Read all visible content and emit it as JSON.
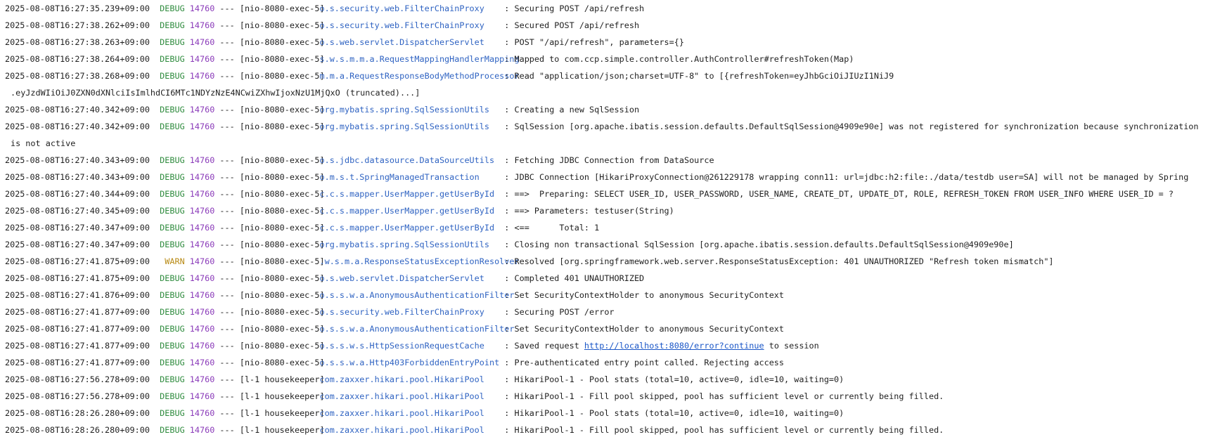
{
  "log": {
    "entries": [
      {
        "ts": "2025-08-08T16:27:35.239+09:00",
        "level": "DEBUG",
        "pid": "14760",
        "sep": "---",
        "thread": "[nio-8080-exec-5]",
        "logger": "o.s.security.web.FilterChainProxy",
        "message": "Securing POST /api/refresh"
      },
      {
        "ts": "2025-08-08T16:27:38.262+09:00",
        "level": "DEBUG",
        "pid": "14760",
        "sep": "---",
        "thread": "[nio-8080-exec-5]",
        "logger": "o.s.security.web.FilterChainProxy",
        "message": "Secured POST /api/refresh"
      },
      {
        "ts": "2025-08-08T16:27:38.263+09:00",
        "level": "DEBUG",
        "pid": "14760",
        "sep": "---",
        "thread": "[nio-8080-exec-5]",
        "logger": "o.s.web.servlet.DispatcherServlet",
        "message": "POST \"/api/refresh\", parameters={}"
      },
      {
        "ts": "2025-08-08T16:27:38.264+09:00",
        "level": "DEBUG",
        "pid": "14760",
        "sep": "---",
        "thread": "[nio-8080-exec-5]",
        "logger": "s.w.s.m.m.a.RequestMappingHandlerMapping",
        "message": "Mapped to com.ccp.simple.controller.AuthController#refreshToken(Map)"
      },
      {
        "ts": "2025-08-08T16:27:38.268+09:00",
        "level": "DEBUG",
        "pid": "14760",
        "sep": "---",
        "thread": "[nio-8080-exec-5]",
        "logger": "m.m.a.RequestResponseBodyMethodProcessor",
        "message": "Read \"application/json;charset=UTF-8\" to [{refreshToken=eyJhbGciOiJIUzI1NiJ9",
        "continuation": ".eyJzdWIiOiJ0ZXN0dXNlciIsImlhdCI6MTc1NDYzNzE4NCwiZXhwIjoxNzU1MjQxO (truncated)...]"
      },
      {
        "ts": "2025-08-08T16:27:40.342+09:00",
        "level": "DEBUG",
        "pid": "14760",
        "sep": "---",
        "thread": "[nio-8080-exec-5]",
        "logger": "org.mybatis.spring.SqlSessionUtils",
        "message": "Creating a new SqlSession"
      },
      {
        "ts": "2025-08-08T16:27:40.342+09:00",
        "level": "DEBUG",
        "pid": "14760",
        "sep": "---",
        "thread": "[nio-8080-exec-5]",
        "logger": "org.mybatis.spring.SqlSessionUtils",
        "message": "SqlSession [org.apache.ibatis.session.defaults.DefaultSqlSession@4909e90e] was not registered for synchronization because synchronization",
        "continuation": "is not active"
      },
      {
        "ts": "2025-08-08T16:27:40.343+09:00",
        "level": "DEBUG",
        "pid": "14760",
        "sep": "---",
        "thread": "[nio-8080-exec-5]",
        "logger": "o.s.jdbc.datasource.DataSourceUtils",
        "message": "Fetching JDBC Connection from DataSource"
      },
      {
        "ts": "2025-08-08T16:27:40.343+09:00",
        "level": "DEBUG",
        "pid": "14760",
        "sep": "---",
        "thread": "[nio-8080-exec-5]",
        "logger": "o.m.s.t.SpringManagedTransaction",
        "message": "JDBC Connection [HikariProxyConnection@261229178 wrapping conn11: url=jdbc:h2:file:./data/testdb user=SA] will not be managed by Spring"
      },
      {
        "ts": "2025-08-08T16:27:40.344+09:00",
        "level": "DEBUG",
        "pid": "14760",
        "sep": "---",
        "thread": "[nio-8080-exec-5]",
        "logger": "c.c.s.mapper.UserMapper.getUserById",
        "message": "==>  Preparing: SELECT USER_ID, USER_PASSWORD, USER_NAME, CREATE_DT, UPDATE_DT, ROLE, REFRESH_TOKEN FROM USER_INFO WHERE USER_ID = ?"
      },
      {
        "ts": "2025-08-08T16:27:40.345+09:00",
        "level": "DEBUG",
        "pid": "14760",
        "sep": "---",
        "thread": "[nio-8080-exec-5]",
        "logger": "c.c.s.mapper.UserMapper.getUserById",
        "message": "==> Parameters: testuser(String)"
      },
      {
        "ts": "2025-08-08T16:27:40.347+09:00",
        "level": "DEBUG",
        "pid": "14760",
        "sep": "---",
        "thread": "[nio-8080-exec-5]",
        "logger": "c.c.s.mapper.UserMapper.getUserById",
        "message": "<==      Total: 1"
      },
      {
        "ts": "2025-08-08T16:27:40.347+09:00",
        "level": "DEBUG",
        "pid": "14760",
        "sep": "---",
        "thread": "[nio-8080-exec-5]",
        "logger": "org.mybatis.spring.SqlSessionUtils",
        "message": "Closing non transactional SqlSession [org.apache.ibatis.session.defaults.DefaultSqlSession@4909e90e]"
      },
      {
        "ts": "2025-08-08T16:27:41.875+09:00",
        "level": "WARN",
        "pid": "14760",
        "sep": "---",
        "thread": "[nio-8080-exec-5]",
        "logger": ".w.s.m.a.ResponseStatusExceptionResolver",
        "message": "Resolved [org.springframework.web.server.ResponseStatusException: 401 UNAUTHORIZED \"Refresh token mismatch\"]"
      },
      {
        "ts": "2025-08-08T16:27:41.875+09:00",
        "level": "DEBUG",
        "pid": "14760",
        "sep": "---",
        "thread": "[nio-8080-exec-5]",
        "logger": "o.s.web.servlet.DispatcherServlet",
        "message": "Completed 401 UNAUTHORIZED"
      },
      {
        "ts": "2025-08-08T16:27:41.876+09:00",
        "level": "DEBUG",
        "pid": "14760",
        "sep": "---",
        "thread": "[nio-8080-exec-5]",
        "logger": "o.s.s.w.a.AnonymousAuthenticationFilter",
        "message": "Set SecurityContextHolder to anonymous SecurityContext"
      },
      {
        "ts": "2025-08-08T16:27:41.877+09:00",
        "level": "DEBUG",
        "pid": "14760",
        "sep": "---",
        "thread": "[nio-8080-exec-5]",
        "logger": "o.s.security.web.FilterChainProxy",
        "message": "Securing POST /error"
      },
      {
        "ts": "2025-08-08T16:27:41.877+09:00",
        "level": "DEBUG",
        "pid": "14760",
        "sep": "---",
        "thread": "[nio-8080-exec-5]",
        "logger": "o.s.s.w.a.AnonymousAuthenticationFilter",
        "message": "Set SecurityContextHolder to anonymous SecurityContext"
      },
      {
        "ts": "2025-08-08T16:27:41.877+09:00",
        "level": "DEBUG",
        "pid": "14760",
        "sep": "---",
        "thread": "[nio-8080-exec-5]",
        "logger": "o.s.s.w.s.HttpSessionRequestCache",
        "message": "Saved request ",
        "url": "http://localhost:8080/error?continue",
        "message_after": " to session"
      },
      {
        "ts": "2025-08-08T16:27:41.877+09:00",
        "level": "DEBUG",
        "pid": "14760",
        "sep": "---",
        "thread": "[nio-8080-exec-5]",
        "logger": "o.s.s.w.a.Http403ForbiddenEntryPoint",
        "message": "Pre-authenticated entry point called. Rejecting access"
      },
      {
        "ts": "2025-08-08T16:27:56.278+09:00",
        "level": "DEBUG",
        "pid": "14760",
        "sep": "---",
        "thread": "[l-1 housekeeper]",
        "logger": "com.zaxxer.hikari.pool.HikariPool",
        "message": "HikariPool-1 - Pool stats (total=10, active=0, idle=10, waiting=0)"
      },
      {
        "ts": "2025-08-08T16:27:56.278+09:00",
        "level": "DEBUG",
        "pid": "14760",
        "sep": "---",
        "thread": "[l-1 housekeeper]",
        "logger": "com.zaxxer.hikari.pool.HikariPool",
        "message": "HikariPool-1 - Fill pool skipped, pool has sufficient level or currently being filled."
      },
      {
        "ts": "2025-08-08T16:28:26.280+09:00",
        "level": "DEBUG",
        "pid": "14760",
        "sep": "---",
        "thread": "[l-1 housekeeper]",
        "logger": "com.zaxxer.hikari.pool.HikariPool",
        "message": "HikariPool-1 - Pool stats (total=10, active=0, idle=10, waiting=0)"
      },
      {
        "ts": "2025-08-08T16:28:26.280+09:00",
        "level": "DEBUG",
        "pid": "14760",
        "sep": "---",
        "thread": "[l-1 housekeeper]",
        "logger": "com.zaxxer.hikari.pool.HikariPool",
        "message": "HikariPool-1 - Fill pool skipped, pool has sufficient level or currently being filled."
      }
    ]
  },
  "colors": {
    "level_debug": "#2e8b3d",
    "level_warn": "#b88a14",
    "pid": "#8a3ab9",
    "logger": "#2f63c2",
    "link": "#1a56c7",
    "text": "#1f1f1f",
    "background": "#ffffff"
  }
}
